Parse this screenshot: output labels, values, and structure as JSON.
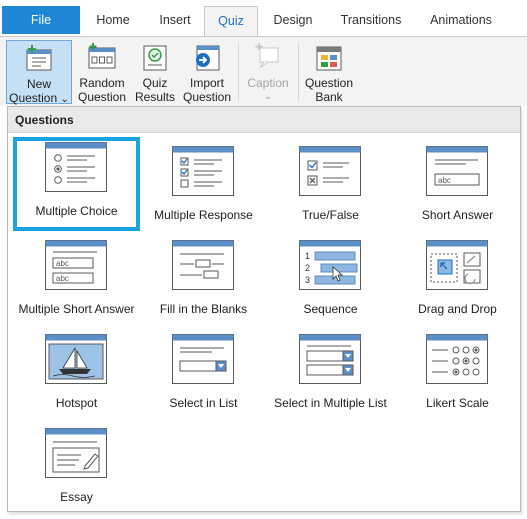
{
  "tabs": [
    {
      "label": "File"
    },
    {
      "label": "Home"
    },
    {
      "label": "Insert"
    },
    {
      "label": "Quiz"
    },
    {
      "label": "Design"
    },
    {
      "label": "Transitions"
    },
    {
      "label": "Animations"
    }
  ],
  "ribbon": {
    "new_question": {
      "line1": "New",
      "line2": "Question",
      "arrow": "⌄"
    },
    "random_question": {
      "line1": "Random",
      "line2": "Question"
    },
    "quiz_results": {
      "line1": "Quiz",
      "line2": "Results"
    },
    "import_question": {
      "line1": "Import",
      "line2": "Question"
    },
    "caption": {
      "line1": "Caption",
      "arrow": "⌄"
    },
    "question_bank": {
      "line1": "Question",
      "line2": "Bank"
    }
  },
  "gallery": {
    "heading": "Questions",
    "items": [
      {
        "label": "Multiple Choice",
        "icon": "multiple-choice-icon"
      },
      {
        "label": "Multiple Response",
        "icon": "multiple-response-icon"
      },
      {
        "label": "True/False",
        "icon": "true-false-icon"
      },
      {
        "label": "Short Answer",
        "icon": "short-answer-icon"
      },
      {
        "label": "Multiple Short Answer",
        "icon": "multiple-short-answer-icon"
      },
      {
        "label": "Fill in the Blanks",
        "icon": "fill-in-the-blanks-icon"
      },
      {
        "label": "Sequence",
        "icon": "sequence-icon"
      },
      {
        "label": "Drag and Drop",
        "icon": "drag-and-drop-icon"
      },
      {
        "label": "Hotspot",
        "icon": "hotspot-icon"
      },
      {
        "label": "Select in List",
        "icon": "select-in-list-icon"
      },
      {
        "label": "Select in Multiple List",
        "icon": "select-in-multiple-list-icon"
      },
      {
        "label": "Likert Scale",
        "icon": "likert-scale-icon"
      },
      {
        "label": "Essay",
        "icon": "essay-icon"
      }
    ],
    "thumb_text": {
      "abc": "abc",
      "seq1": "1",
      "seq2": "2",
      "seq3": "3"
    }
  },
  "colors": {
    "accent": "#1e86d6",
    "selection": "#1aa3e0",
    "thumb_header": "#5b8fc7",
    "pressed": "#c5dff5"
  }
}
